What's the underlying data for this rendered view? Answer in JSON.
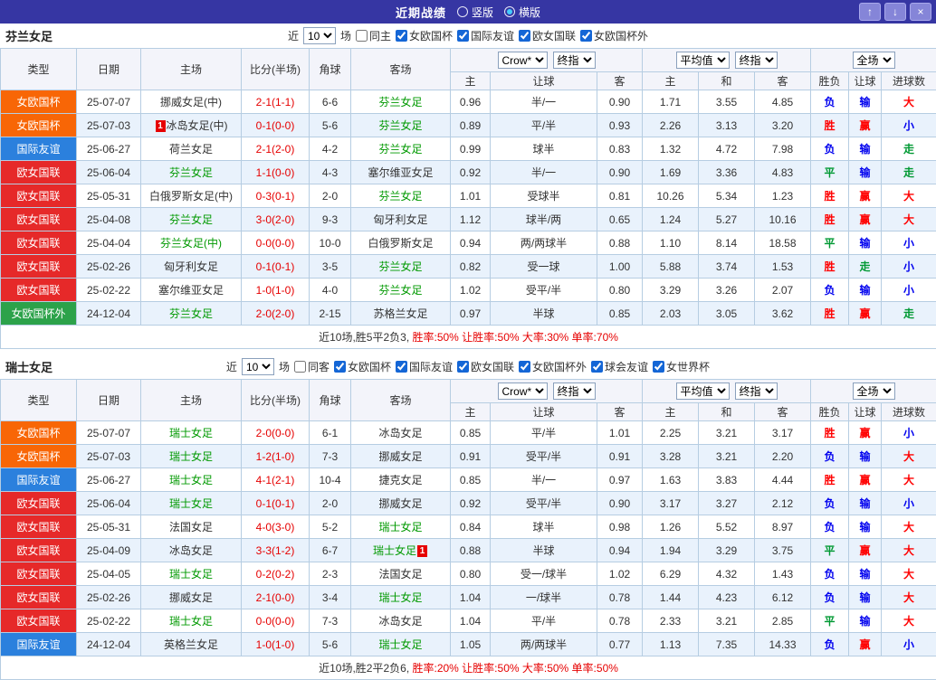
{
  "titlebar": {
    "title": "近期战绩",
    "layout_options": [
      {
        "label": "竖版",
        "selected": false
      },
      {
        "label": "横版",
        "selected": true
      }
    ],
    "up_symbol": "↑",
    "down_symbol": "↓",
    "close_symbol": "×"
  },
  "table_header": {
    "static_cols": [
      "类型",
      "日期",
      "主场",
      "比分(半场)",
      "角球",
      "客场"
    ],
    "groups": [
      {
        "selects": [
          "Crow*",
          "终指"
        ],
        "cols": [
          "主",
          "让球",
          "客"
        ]
      },
      {
        "selects": [
          "平均值",
          "终指"
        ],
        "cols": [
          "主",
          "和",
          "客"
        ]
      },
      {
        "selects": [
          "全场"
        ],
        "cols": [
          "胜负",
          "让球",
          "进球数"
        ]
      }
    ]
  },
  "type_colors": {
    "女欧国杯": "#f86606",
    "国际友谊": "#2b80dd",
    "欧女国联": "#e62929",
    "女欧国杯外": "#2ca24a"
  },
  "result_colors": {
    "r": "#ff0000",
    "b": "#0000ee",
    "g": "#009933"
  },
  "sections": [
    {
      "team": "芬兰女足",
      "filter": {
        "prefix": "近",
        "count": "10",
        "suffix": "场",
        "checkboxes": [
          {
            "label": "同主",
            "checked": false
          },
          {
            "label": "女欧国杯",
            "checked": true
          },
          {
            "label": "国际友谊",
            "checked": true
          },
          {
            "label": "欧女国联",
            "checked": true
          },
          {
            "label": "女欧国杯外",
            "checked": true
          }
        ]
      },
      "rows": [
        {
          "type": "女欧国杯",
          "date": "25-07-07",
          "home": "挪威女足(中)",
          "home_focus": false,
          "home_card": "",
          "score": "2-1(1-1)",
          "corner": "6-6",
          "away": "芬兰女足",
          "away_focus": true,
          "away_card": "",
          "odds": [
            "0.96",
            "半/一",
            "0.90"
          ],
          "avg": [
            "1.71",
            "3.55",
            "4.85"
          ],
          "results": [
            [
              "负",
              "b"
            ],
            [
              "输",
              "b"
            ],
            [
              "大",
              "r"
            ]
          ]
        },
        {
          "type": "女欧国杯",
          "date": "25-07-03",
          "home": "冰岛女足(中)",
          "home_focus": false,
          "home_card": "1",
          "score": "0-1(0-0)",
          "corner": "5-6",
          "away": "芬兰女足",
          "away_focus": true,
          "away_card": "",
          "odds": [
            "0.89",
            "平/半",
            "0.93"
          ],
          "avg": [
            "2.26",
            "3.13",
            "3.20"
          ],
          "results": [
            [
              "胜",
              "r"
            ],
            [
              "赢",
              "r"
            ],
            [
              "小",
              "b"
            ]
          ]
        },
        {
          "type": "国际友谊",
          "date": "25-06-27",
          "home": "荷兰女足",
          "home_focus": false,
          "home_card": "",
          "score": "2-1(2-0)",
          "corner": "4-2",
          "away": "芬兰女足",
          "away_focus": true,
          "away_card": "",
          "odds": [
            "0.99",
            "球半",
            "0.83"
          ],
          "avg": [
            "1.32",
            "4.72",
            "7.98"
          ],
          "results": [
            [
              "负",
              "b"
            ],
            [
              "输",
              "b"
            ],
            [
              "走",
              "g"
            ]
          ]
        },
        {
          "type": "欧女国联",
          "date": "25-06-04",
          "home": "芬兰女足",
          "home_focus": true,
          "home_card": "",
          "score": "1-1(0-0)",
          "corner": "4-3",
          "away": "塞尔维亚女足",
          "away_focus": false,
          "away_card": "",
          "odds": [
            "0.92",
            "半/一",
            "0.90"
          ],
          "avg": [
            "1.69",
            "3.36",
            "4.83"
          ],
          "results": [
            [
              "平",
              "g"
            ],
            [
              "输",
              "b"
            ],
            [
              "走",
              "g"
            ]
          ]
        },
        {
          "type": "欧女国联",
          "date": "25-05-31",
          "home": "白俄罗斯女足(中)",
          "home_focus": false,
          "home_card": "",
          "score": "0-3(0-1)",
          "corner": "2-0",
          "away": "芬兰女足",
          "away_focus": true,
          "away_card": "",
          "odds": [
            "1.01",
            "受球半",
            "0.81"
          ],
          "avg": [
            "10.26",
            "5.34",
            "1.23"
          ],
          "results": [
            [
              "胜",
              "r"
            ],
            [
              "赢",
              "r"
            ],
            [
              "大",
              "r"
            ]
          ]
        },
        {
          "type": "欧女国联",
          "date": "25-04-08",
          "home": "芬兰女足",
          "home_focus": true,
          "home_card": "",
          "score": "3-0(2-0)",
          "corner": "9-3",
          "away": "匈牙利女足",
          "away_focus": false,
          "away_card": "",
          "odds": [
            "1.12",
            "球半/两",
            "0.65"
          ],
          "avg": [
            "1.24",
            "5.27",
            "10.16"
          ],
          "results": [
            [
              "胜",
              "r"
            ],
            [
              "赢",
              "r"
            ],
            [
              "大",
              "r"
            ]
          ]
        },
        {
          "type": "欧女国联",
          "date": "25-04-04",
          "home": "芬兰女足(中)",
          "home_focus": true,
          "home_card": "",
          "score": "0-0(0-0)",
          "corner": "10-0",
          "away": "白俄罗斯女足",
          "away_focus": false,
          "away_card": "",
          "odds": [
            "0.94",
            "两/两球半",
            "0.88"
          ],
          "avg": [
            "1.10",
            "8.14",
            "18.58"
          ],
          "results": [
            [
              "平",
              "g"
            ],
            [
              "输",
              "b"
            ],
            [
              "小",
              "b"
            ]
          ]
        },
        {
          "type": "欧女国联",
          "date": "25-02-26",
          "home": "匈牙利女足",
          "home_focus": false,
          "home_card": "",
          "score": "0-1(0-1)",
          "corner": "3-5",
          "away": "芬兰女足",
          "away_focus": true,
          "away_card": "",
          "odds": [
            "0.82",
            "受一球",
            "1.00"
          ],
          "avg": [
            "5.88",
            "3.74",
            "1.53"
          ],
          "results": [
            [
              "胜",
              "r"
            ],
            [
              "走",
              "g"
            ],
            [
              "小",
              "b"
            ]
          ]
        },
        {
          "type": "欧女国联",
          "date": "25-02-22",
          "home": "塞尔维亚女足",
          "home_focus": false,
          "home_card": "",
          "score": "1-0(1-0)",
          "corner": "4-0",
          "away": "芬兰女足",
          "away_focus": true,
          "away_card": "",
          "odds": [
            "1.02",
            "受平/半",
            "0.80"
          ],
          "avg": [
            "3.29",
            "3.26",
            "2.07"
          ],
          "results": [
            [
              "负",
              "b"
            ],
            [
              "输",
              "b"
            ],
            [
              "小",
              "b"
            ]
          ]
        },
        {
          "type": "女欧国杯外",
          "date": "24-12-04",
          "home": "芬兰女足",
          "home_focus": true,
          "home_card": "",
          "score": "2-0(2-0)",
          "corner": "2-15",
          "away": "苏格兰女足",
          "away_focus": false,
          "away_card": "",
          "odds": [
            "0.97",
            "半球",
            "0.85"
          ],
          "avg": [
            "2.03",
            "3.05",
            "3.62"
          ],
          "results": [
            [
              "胜",
              "r"
            ],
            [
              "赢",
              "r"
            ],
            [
              "走",
              "g"
            ]
          ]
        }
      ],
      "summary": {
        "record": "近10场,胜5平2负3,",
        "rates": "胜率:50% 让胜率:50% 大率:30% 单率:70%"
      }
    },
    {
      "team": "瑞士女足",
      "filter": {
        "prefix": "近",
        "count": "10",
        "suffix": "场",
        "checkboxes": [
          {
            "label": "同客",
            "checked": false
          },
          {
            "label": "女欧国杯",
            "checked": true
          },
          {
            "label": "国际友谊",
            "checked": true
          },
          {
            "label": "欧女国联",
            "checked": true
          },
          {
            "label": "女欧国杯外",
            "checked": true
          },
          {
            "label": "球会友谊",
            "checked": true
          },
          {
            "label": "女世界杯",
            "checked": true
          }
        ]
      },
      "rows": [
        {
          "type": "女欧国杯",
          "date": "25-07-07",
          "home": "瑞士女足",
          "home_focus": true,
          "home_card": "",
          "score": "2-0(0-0)",
          "corner": "6-1",
          "away": "冰岛女足",
          "away_focus": false,
          "away_card": "",
          "odds": [
            "0.85",
            "平/半",
            "1.01"
          ],
          "avg": [
            "2.25",
            "3.21",
            "3.17"
          ],
          "results": [
            [
              "胜",
              "r"
            ],
            [
              "赢",
              "r"
            ],
            [
              "小",
              "b"
            ]
          ]
        },
        {
          "type": "女欧国杯",
          "date": "25-07-03",
          "home": "瑞士女足",
          "home_focus": true,
          "home_card": "",
          "score": "1-2(1-0)",
          "corner": "7-3",
          "away": "挪威女足",
          "away_focus": false,
          "away_card": "",
          "odds": [
            "0.91",
            "受平/半",
            "0.91"
          ],
          "avg": [
            "3.28",
            "3.21",
            "2.20"
          ],
          "results": [
            [
              "负",
              "b"
            ],
            [
              "输",
              "b"
            ],
            [
              "大",
              "r"
            ]
          ]
        },
        {
          "type": "国际友谊",
          "date": "25-06-27",
          "home": "瑞士女足",
          "home_focus": true,
          "home_card": "",
          "score": "4-1(2-1)",
          "corner": "10-4",
          "away": "捷克女足",
          "away_focus": false,
          "away_card": "",
          "odds": [
            "0.85",
            "半/一",
            "0.97"
          ],
          "avg": [
            "1.63",
            "3.83",
            "4.44"
          ],
          "results": [
            [
              "胜",
              "r"
            ],
            [
              "赢",
              "r"
            ],
            [
              "大",
              "r"
            ]
          ]
        },
        {
          "type": "欧女国联",
          "date": "25-06-04",
          "home": "瑞士女足",
          "home_focus": true,
          "home_card": "",
          "score": "0-1(0-1)",
          "corner": "2-0",
          "away": "挪威女足",
          "away_focus": false,
          "away_card": "",
          "odds": [
            "0.92",
            "受平/半",
            "0.90"
          ],
          "avg": [
            "3.17",
            "3.27",
            "2.12"
          ],
          "results": [
            [
              "负",
              "b"
            ],
            [
              "输",
              "b"
            ],
            [
              "小",
              "b"
            ]
          ]
        },
        {
          "type": "欧女国联",
          "date": "25-05-31",
          "home": "法国女足",
          "home_focus": false,
          "home_card": "",
          "score": "4-0(3-0)",
          "corner": "5-2",
          "away": "瑞士女足",
          "away_focus": true,
          "away_card": "",
          "odds": [
            "0.84",
            "球半",
            "0.98"
          ],
          "avg": [
            "1.26",
            "5.52",
            "8.97"
          ],
          "results": [
            [
              "负",
              "b"
            ],
            [
              "输",
              "b"
            ],
            [
              "大",
              "r"
            ]
          ]
        },
        {
          "type": "欧女国联",
          "date": "25-04-09",
          "home": "冰岛女足",
          "home_focus": false,
          "home_card": "",
          "score": "3-3(1-2)",
          "corner": "6-7",
          "away": "瑞士女足",
          "away_focus": true,
          "away_card": "1",
          "odds": [
            "0.88",
            "半球",
            "0.94"
          ],
          "avg": [
            "1.94",
            "3.29",
            "3.75"
          ],
          "results": [
            [
              "平",
              "g"
            ],
            [
              "赢",
              "r"
            ],
            [
              "大",
              "r"
            ]
          ]
        },
        {
          "type": "欧女国联",
          "date": "25-04-05",
          "home": "瑞士女足",
          "home_focus": true,
          "home_card": "",
          "score": "0-2(0-2)",
          "corner": "2-3",
          "away": "法国女足",
          "away_focus": false,
          "away_card": "",
          "odds": [
            "0.80",
            "受一/球半",
            "1.02"
          ],
          "avg": [
            "6.29",
            "4.32",
            "1.43"
          ],
          "results": [
            [
              "负",
              "b"
            ],
            [
              "输",
              "b"
            ],
            [
              "大",
              "r"
            ]
          ]
        },
        {
          "type": "欧女国联",
          "date": "25-02-26",
          "home": "挪威女足",
          "home_focus": false,
          "home_card": "",
          "score": "2-1(0-0)",
          "corner": "3-4",
          "away": "瑞士女足",
          "away_focus": true,
          "away_card": "",
          "odds": [
            "1.04",
            "一/球半",
            "0.78"
          ],
          "avg": [
            "1.44",
            "4.23",
            "6.12"
          ],
          "results": [
            [
              "负",
              "b"
            ],
            [
              "输",
              "b"
            ],
            [
              "大",
              "r"
            ]
          ]
        },
        {
          "type": "欧女国联",
          "date": "25-02-22",
          "home": "瑞士女足",
          "home_focus": true,
          "home_card": "",
          "score": "0-0(0-0)",
          "corner": "7-3",
          "away": "冰岛女足",
          "away_focus": false,
          "away_card": "",
          "odds": [
            "1.04",
            "平/半",
            "0.78"
          ],
          "avg": [
            "2.33",
            "3.21",
            "2.85"
          ],
          "results": [
            [
              "平",
              "g"
            ],
            [
              "输",
              "b"
            ],
            [
              "大",
              "r"
            ]
          ]
        },
        {
          "type": "国际友谊",
          "date": "24-12-04",
          "home": "英格兰女足",
          "home_focus": false,
          "home_card": "",
          "score": "1-0(1-0)",
          "corner": "5-6",
          "away": "瑞士女足",
          "away_focus": true,
          "away_card": "",
          "odds": [
            "1.05",
            "两/两球半",
            "0.77"
          ],
          "avg": [
            "1.13",
            "7.35",
            "14.33"
          ],
          "results": [
            [
              "负",
              "b"
            ],
            [
              "赢",
              "r"
            ],
            [
              "小",
              "b"
            ]
          ]
        }
      ],
      "summary": {
        "record": "近10场,胜2平2负6,",
        "rates": "胜率:20% 让胜率:50% 大率:50% 单率:50%"
      }
    }
  ]
}
